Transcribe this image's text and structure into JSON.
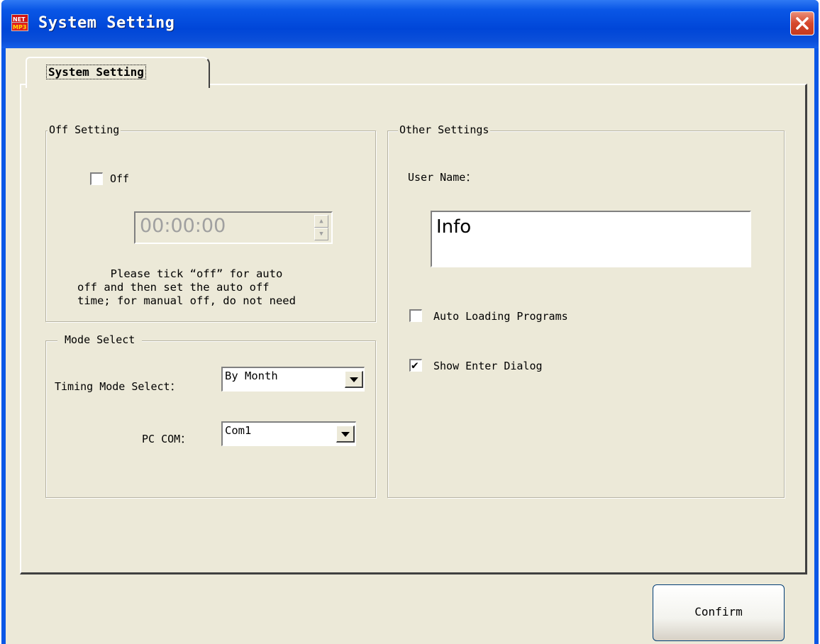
{
  "window": {
    "title": "System Setting",
    "close_icon": "close-x-icon",
    "app_icon": "app-logo-icon"
  },
  "tab": {
    "label": "System Setting"
  },
  "off_setting": {
    "legend": "Off Setting",
    "off_checkbox": {
      "label": "Off",
      "checked": false
    },
    "time_value": "00:00:00",
    "description": "     Please tick “off” for auto\noff and then set the auto off\ntime; for manual off, do not need"
  },
  "mode_select": {
    "legend": "Mode Select",
    "timing_label": "Timing Mode Select：",
    "timing_value": "By Month",
    "pc_com_label": "PC COM：",
    "pc_com_value": "Com1"
  },
  "other_settings": {
    "legend": "Other Settings",
    "user_name_label": "User Name：",
    "user_name_value": "Info",
    "auto_loading": {
      "label": "Auto Loading Programs",
      "checked": false
    },
    "show_enter": {
      "label": "Show Enter Dialog",
      "checked": true
    }
  },
  "footer": {
    "confirm_label": "Confirm"
  },
  "colors": {
    "titlebar": "#0a57e6",
    "client": "#ece9d8",
    "close_button": "#d6472c"
  }
}
